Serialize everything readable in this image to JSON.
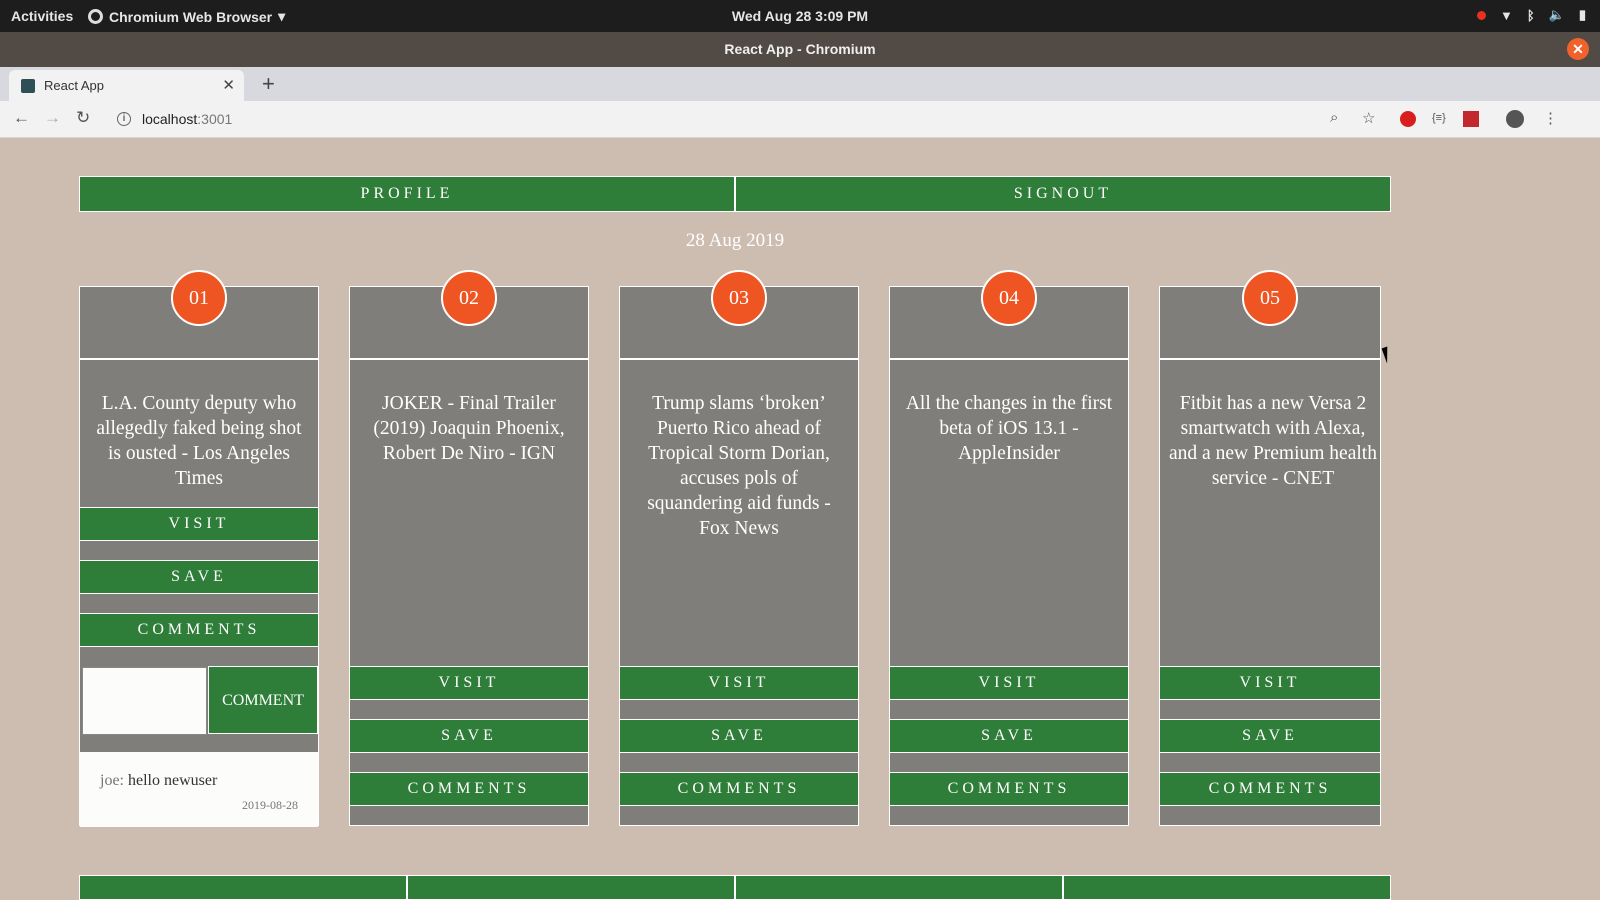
{
  "system": {
    "activities": "Activities",
    "app_menu": "Chromium Web Browser",
    "clock": "Wed Aug 28  3:09 PM"
  },
  "window": {
    "title": "React App - Chromium"
  },
  "browser": {
    "tab_title": "React App",
    "url_host": "localhost",
    "url_port": ":3001"
  },
  "app": {
    "nav": {
      "profile": "PROFILE",
      "signout": "SIGNOUT"
    },
    "date": "28 Aug 2019",
    "cards": [
      {
        "number": "01",
        "headline": "L.A. County deputy who allegedly faked being shot is ousted - Los Angeles Times",
        "visit": "VISIT",
        "save": "SAVE",
        "comments": "COMMENTS"
      },
      {
        "number": "02",
        "headline": "JOKER - Final Trailer (2019) Joaquin Phoenix, Robert De Niro - IGN",
        "visit": "VISIT",
        "save": "SAVE",
        "comments": "COMMENTS"
      },
      {
        "number": "03",
        "headline": "Trump slams ‘broken’ Puerto Rico ahead of Tropical Storm Dorian, accuses pols of squandering aid funds - Fox News",
        "visit": "VISIT",
        "save": "SAVE",
        "comments": "COMMENTS"
      },
      {
        "number": "04",
        "headline": "All the changes in the first beta of iOS 13.1 - AppleInsider",
        "visit": "VISIT",
        "save": "SAVE",
        "comments": "COMMENTS"
      },
      {
        "number": "05",
        "headline": "Fitbit has a new Versa 2 smartwatch with Alexa, and a new Premium health service - CNET",
        "visit": "VISIT",
        "save": "SAVE",
        "comments": "COMMENTS"
      }
    ],
    "comment_form": {
      "button": "COMMENT",
      "value": ""
    },
    "comment": {
      "user": "joe:",
      "text": "hello newuser",
      "date": "2019-08-28"
    }
  },
  "colors": {
    "green": "#2e7d38",
    "badge": "#ee5522",
    "card": "#7f7e7a",
    "background": "#cdbcb0"
  }
}
